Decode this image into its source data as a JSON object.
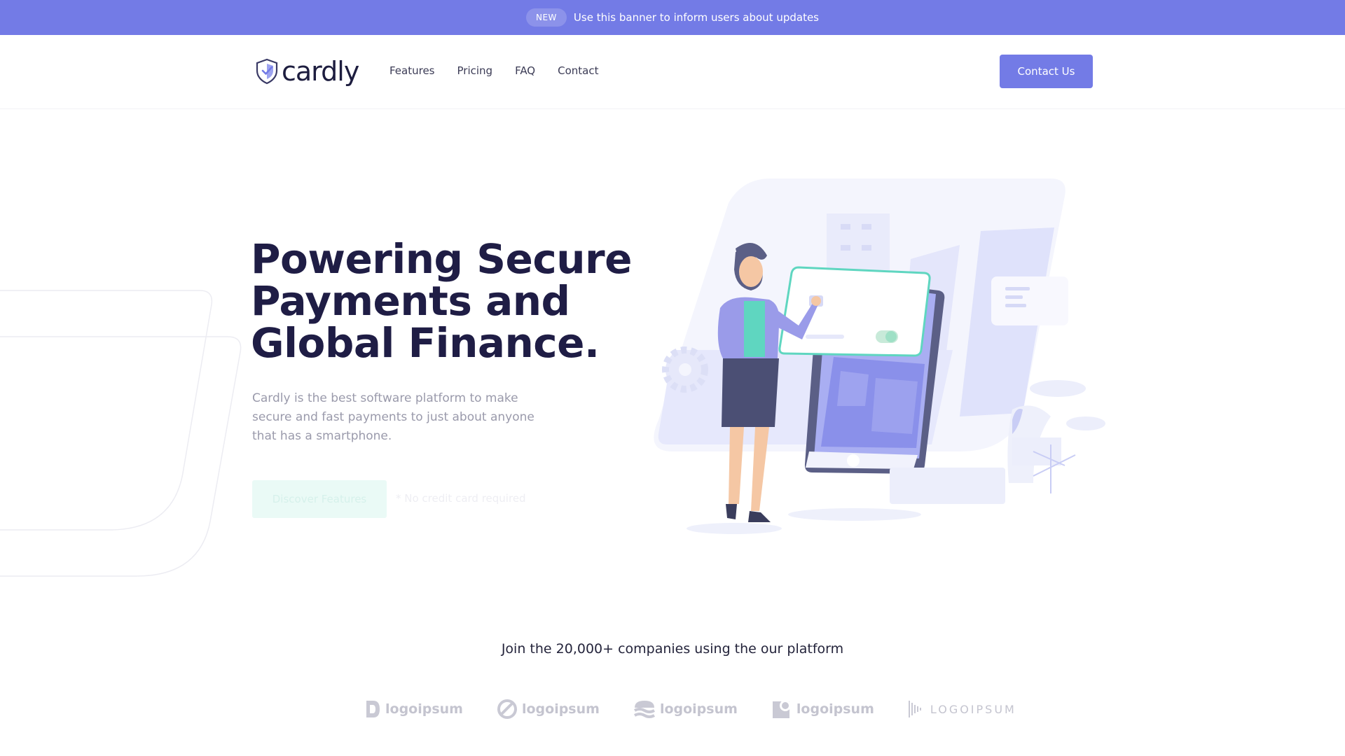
{
  "banner": {
    "badge": "NEW",
    "message": "Use this banner to inform users about updates"
  },
  "header": {
    "logo_text": "cardly",
    "nav": [
      "Features",
      "Pricing",
      "FAQ",
      "Contact"
    ],
    "cta": "Contact Us"
  },
  "hero": {
    "title_lines": [
      "Powering Secure",
      "Payments and",
      "Global Finance."
    ],
    "subtitle": "Cardly is the best software platform to make secure and fast payments to just about anyone that has a smartphone.",
    "cta": "Discover Features",
    "note": "* No credit card required"
  },
  "social": {
    "heading": "Join the 20,000+ companies using the our platform",
    "logos": [
      "logoipsum",
      "logoipsum",
      "logoipsum",
      "logoipsum",
      "LOGOIPSUM"
    ]
  },
  "colors": {
    "accent": "#737be6",
    "heading": "#1f1d45",
    "teal": "#5fd6c0"
  }
}
